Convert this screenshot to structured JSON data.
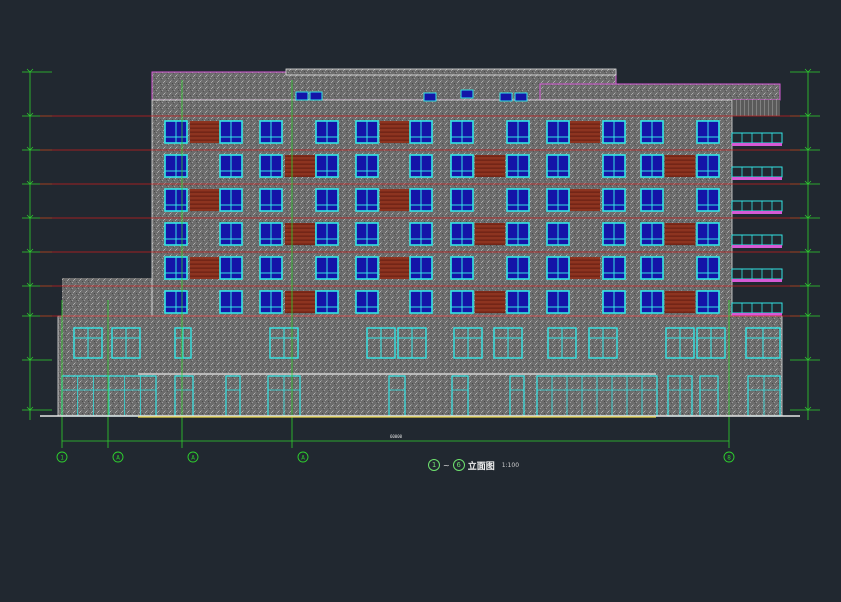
{
  "drawing": {
    "title": "立面图",
    "scale": "1:100",
    "title_axis_start": "1",
    "title_axis_end": "6",
    "title_connector": "~",
    "axes": [
      "1",
      "A",
      "A",
      "A",
      "8"
    ],
    "total_dimension": "60000"
  },
  "colors": {
    "background": "#212830",
    "facade_fill": "#6e6e6e",
    "window_frame": "#33e5e5",
    "window_glass": "#1414a8",
    "panel": "#8a2e1e",
    "floor_line": "#c81e1e",
    "grid_line": "#2ed12e",
    "roof_outline": "#d65ad6",
    "ground": "#e6e6e6"
  }
}
